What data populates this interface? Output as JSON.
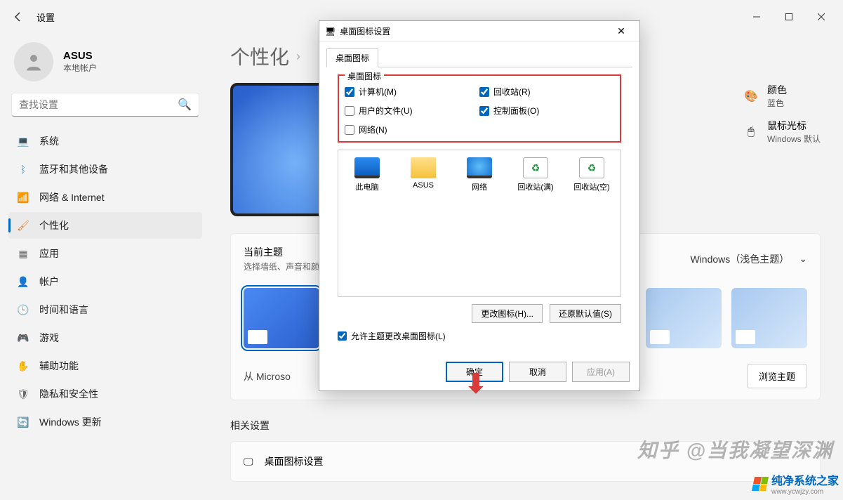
{
  "window": {
    "title": "设置"
  },
  "user": {
    "name": "ASUS",
    "subtitle": "本地帐户"
  },
  "search": {
    "placeholder": "查找设置"
  },
  "nav": {
    "items": [
      {
        "label": "系统",
        "icon": "💻"
      },
      {
        "label": "蓝牙和其他设备",
        "icon": "ᛒ"
      },
      {
        "label": "网络 & Internet",
        "icon": "📶"
      },
      {
        "label": "个性化",
        "icon": "🖌"
      },
      {
        "label": "应用",
        "icon": "▦"
      },
      {
        "label": "帐户",
        "icon": "👤"
      },
      {
        "label": "时间和语言",
        "icon": "🕒"
      },
      {
        "label": "游戏",
        "icon": "🎮"
      },
      {
        "label": "辅助功能",
        "icon": "✋"
      },
      {
        "label": "隐私和安全性",
        "icon": "🛡"
      },
      {
        "label": "Windows 更新",
        "icon": "🔄"
      }
    ]
  },
  "breadcrumb": {
    "root": "个性化"
  },
  "right_opts": {
    "color": {
      "title": "颜色",
      "sub": "蓝色"
    },
    "cursor": {
      "title": "鼠标光标",
      "sub": "Windows 默认"
    }
  },
  "theme": {
    "title": "当前主题",
    "sub": "选择墙纸、声音和颜",
    "selector": "Windows（浅色主题）",
    "store": "从 Microso",
    "browse": "浏览主题"
  },
  "related": {
    "title": "相关设置",
    "desktop_icons": "桌面图标设置"
  },
  "dialog": {
    "title": "桌面图标设置",
    "tab": "桌面图标",
    "group": "桌面图标",
    "chk": {
      "computer": "计算机(M)",
      "recycle": "回收站(R)",
      "userfiles": "用户的文件(U)",
      "control": "控制面板(O)",
      "network": "网络(N)"
    },
    "preview": {
      "thispc": "此电脑",
      "asus": "ASUS",
      "network": "网络",
      "binfull": "回收站(满)",
      "binempty": "回收站(空)"
    },
    "change_icon": "更改图标(H)...",
    "restore": "还原默认值(S)",
    "allow": "允许主题更改桌面图标(L)",
    "ok": "确定",
    "cancel": "取消",
    "apply": "应用(A)"
  },
  "watermark": {
    "text1": "知乎 @当我凝望深渊",
    "brand": "纯净系统之家",
    "url": "www.ycwjzy.com"
  }
}
